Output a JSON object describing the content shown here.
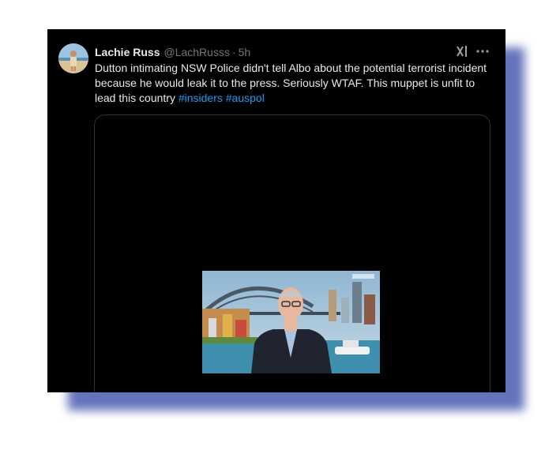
{
  "tweet": {
    "author_name": "Lachie Russ",
    "handle": "@LachRusss",
    "separator": "·",
    "time": "5h",
    "text_main": "Dutton intimating NSW Police didn't tell Albo about the potential terrorist incident because he would leak it to the press. Seriously WTAF. This muppet is unfit to lead this country ",
    "hashtags": [
      "#insiders",
      "#auspol"
    ]
  },
  "icons": {
    "grok": "grok-icon",
    "more": "more-icon"
  },
  "colors": {
    "background": "#000000",
    "text": "#e7e9ea",
    "muted": "#71767b",
    "link": "#1d9bf0",
    "shadow": "#4a5bb0"
  }
}
